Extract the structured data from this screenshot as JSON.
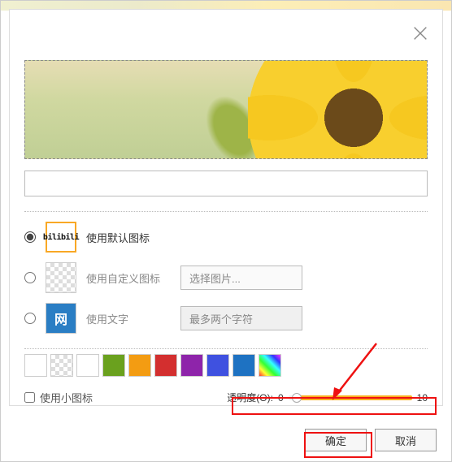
{
  "options": {
    "default_icon_label": "使用默认图标",
    "custom_icon_label": "使用自定义图标",
    "text_icon_label": "使用文字",
    "pick_image_btn": "选择图片...",
    "text_placeholder": "最多两个字符",
    "wang_char": "网",
    "bilibili_text": "bilibili"
  },
  "small_icon_label": "使用小图标",
  "opacity": {
    "label_prefix": "透明度(O):",
    "min": "0",
    "max": "10"
  },
  "buttons": {
    "ok": "确定",
    "cancel": "取消"
  },
  "swatch_colors": [
    "#ffffff",
    "checker",
    "#ffffff",
    "#6aa11e",
    "#f39c12",
    "#d32f2f",
    "#8e24aa",
    "#3f51e0",
    "#1e72c2",
    "rainbow"
  ]
}
